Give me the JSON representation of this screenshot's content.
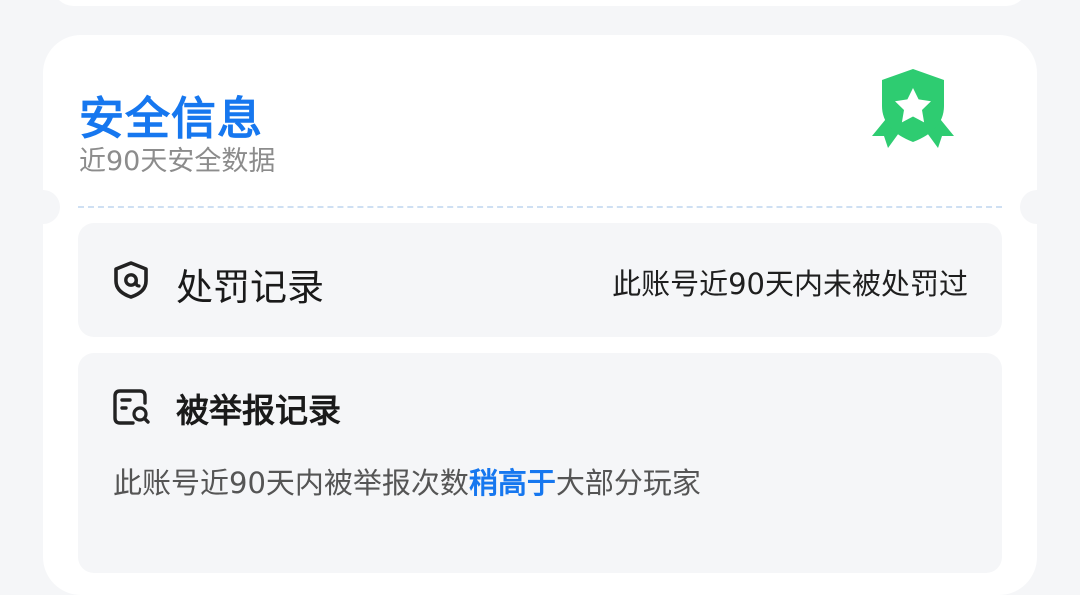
{
  "security": {
    "title": "安全信息",
    "subtitle": "近90天安全数据",
    "badge_icon": "shield-star-ribbon-icon",
    "colors": {
      "accent": "#1677ef",
      "badge": "#2ecc71"
    }
  },
  "penalty": {
    "icon": "shield-at-icon",
    "label": "处罚记录",
    "status": "此账号近90天内未被处罚过"
  },
  "report": {
    "icon": "document-search-icon",
    "label": "被举报记录",
    "desc_prefix": "此账号近90天内被举报次数",
    "desc_highlight": "稍高于",
    "desc_suffix": "大部分玩家"
  }
}
